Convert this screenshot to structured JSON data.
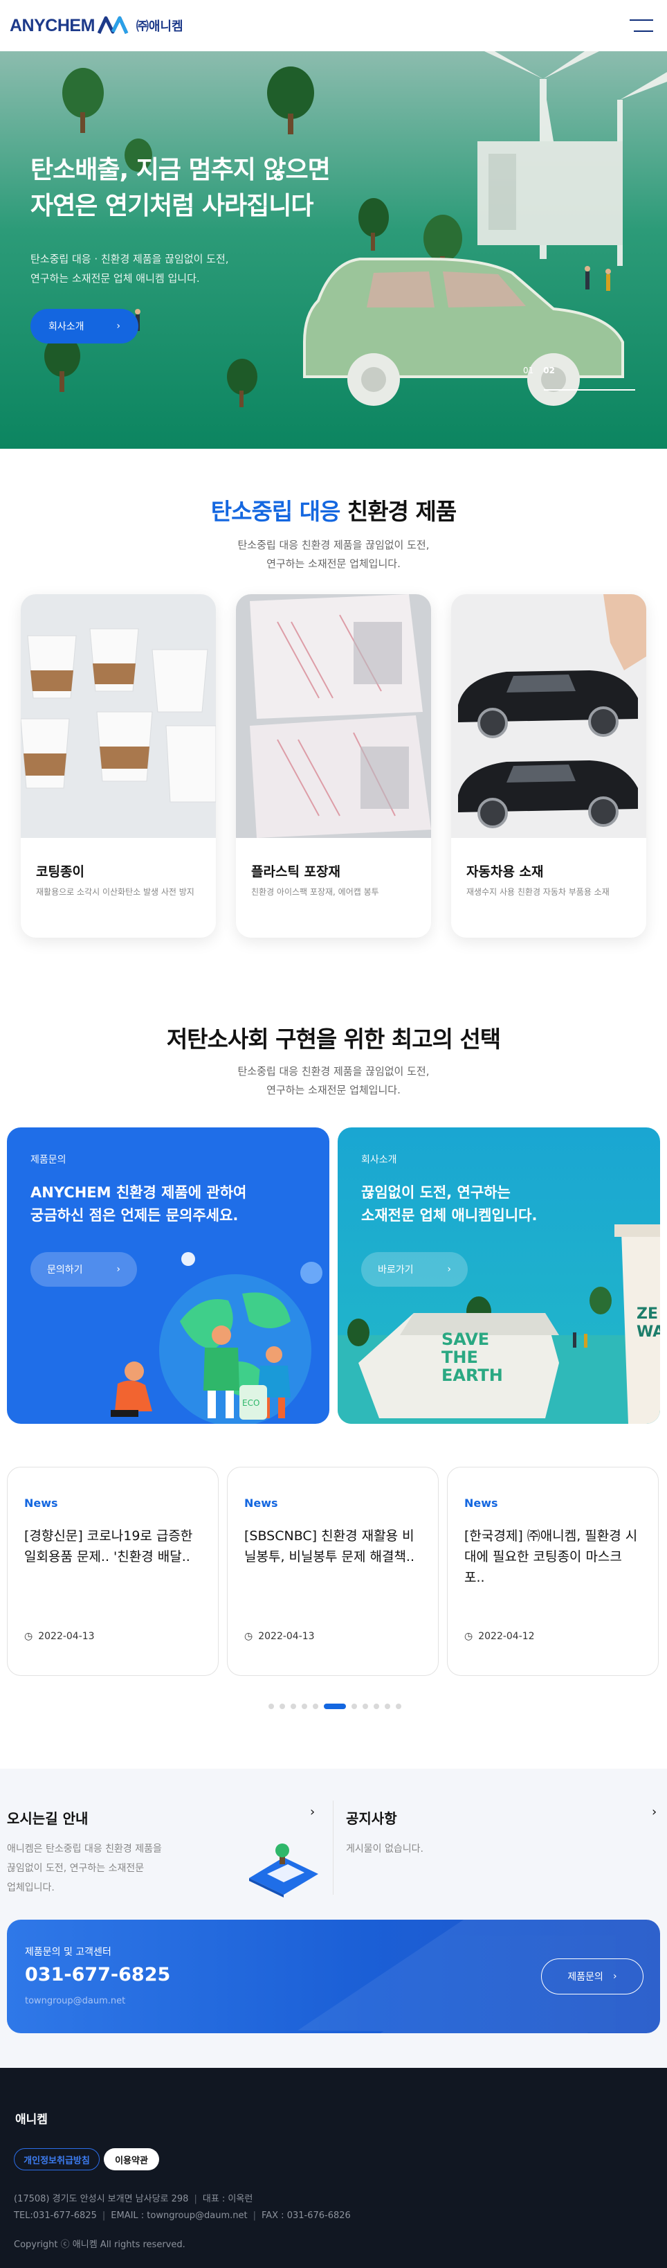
{
  "header": {
    "logo_text": "ANYCHEM",
    "logo_ko": "㈜애니켐",
    "menu_icon": "hamburger-icon"
  },
  "hero": {
    "title_line1": "탄소배출, 지금 멈추지 않으면",
    "title_line2": "자연은 연기처럼 사라집니다",
    "desc_line1": "탄소중립 대응 · 친환경 제품을 끊임없이 도전,",
    "desc_line2": "연구하는 소재전문 업체 애니켐 입니다.",
    "button_label": "회사소개",
    "slide_1": "01",
    "slide_2": "02",
    "active_slide": 2,
    "progress": 1.0
  },
  "products": {
    "title_blue": "탄소중립 대응",
    "title_black": "친환경 제품",
    "desc_line1": "탄소중립 대응 친환경 제품을 끊임없이 도전,",
    "desc_line2": "연구하는 소재전문 업체입니다.",
    "items": [
      {
        "name": "코팅종이",
        "sub": "재활용으로 소각시 이산화탄소 발생 사전 방지"
      },
      {
        "name": "플라스틱 포장재",
        "sub": "친환경 아이스팩 포장재, 에어캡 봉투"
      },
      {
        "name": "자동차용 소재",
        "sub": "재생수지 사용 친환경 자동차 부품용 소재"
      }
    ]
  },
  "choice": {
    "title": "저탄소사회 구현을 위한 최고의 선택",
    "desc_line1": "탄소중립 대응 친환경 제품을 끊임없이 도전,",
    "desc_line2": "연구하는 소재전문 업체입니다.",
    "cards": [
      {
        "kicker": "제품문의",
        "head_line1": "ANYCHEM 친환경 제품에 관하여",
        "head_line2": "궁금하신 점은 언제든 문의주세요.",
        "cta": "문의하기",
        "bg": "#1f6ee8"
      },
      {
        "kicker": "회사소개",
        "head_line1": "끊임없이 도전, 연구하는",
        "head_line2": "소재전문 업체 애니켐입니다.",
        "cta": "바로가기",
        "bg": "#13a8cf"
      }
    ],
    "box_text_1": "SAVE",
    "box_text_2": "THE",
    "box_text_3": "EARTH",
    "cup_text_1": "ZE",
    "cup_text_2": "WA",
    "bag_text": "ECO"
  },
  "news": {
    "items": [
      {
        "category": "News",
        "title": "[경향신문] 코로나19로 급증한 일회용품 문제.. '친환경 배달..",
        "date": "2022-04-13"
      },
      {
        "category": "News",
        "title": "[SBSCNBC] 친환경 재활용 비닐봉투, 비닐봉투 문제 해결책..",
        "date": "2022-04-13"
      },
      {
        "category": "News",
        "title": "[한국경제] ㈜애니켐, 필환경 시대에 필요한 코팅종이 마스크 포..",
        "date": "2022-04-12"
      }
    ],
    "dot_count": 11,
    "active_dot": 5
  },
  "info": {
    "directions_title": "오시는길 안내",
    "directions_text_1": "애니켐은 탄소중립 대응 친환경 제품을",
    "directions_text_2": "끊임없이 도전, 연구하는 소재전문",
    "directions_text_3": "업체입니다.",
    "notice_title": "공지사항",
    "notice_text": "게시물이 없습니다."
  },
  "contact": {
    "kicker": "제품문의 및 고객센터",
    "tel": "031-677-6825",
    "email": "towngroup@daum.net",
    "button": "제품문의"
  },
  "footer": {
    "brand": "애니켐",
    "privacy": "개인정보취급방침",
    "terms": "이용약관",
    "address": "(17508) 경기도 안성시 보개면 남사당로 298",
    "ceo": "대표 : 이옥런",
    "tel": "TEL:031-677-6825",
    "email": "EMAIL : towngroup@daum.net",
    "fax": "FAX : 031-676-6826",
    "copyright": "Copyright ⓒ 애니켐 All rights reserved."
  },
  "colors": {
    "brand_blue": "#1467e0",
    "navy": "#1d3a8a",
    "footer_bg": "#111722",
    "hero_green": "#0f8a63"
  }
}
